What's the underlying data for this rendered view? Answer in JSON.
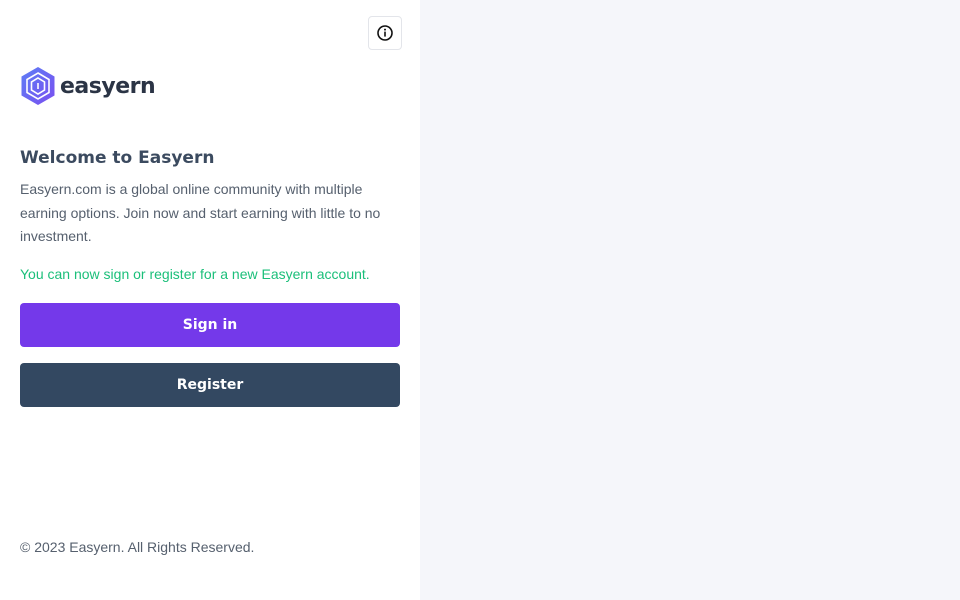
{
  "app": {
    "brand_name": "easyern"
  },
  "header": {
    "info_icon": "info-circle-icon"
  },
  "welcome": {
    "title": "Welcome to Easyern",
    "description": "Easyern.com is a global online community with multiple earning options. Join now and start earning with little to no investment.",
    "status_message": "You can now sign or register for a new Easyern account."
  },
  "actions": {
    "sign_in_label": "Sign in",
    "register_label": "Register"
  },
  "footer": {
    "copyright": "© 2023 Easyern. All Rights Reserved."
  },
  "colors": {
    "primary": "#7439ea",
    "secondary": "#334861",
    "success": "#1bbf7a",
    "logo_accent": "#6b5cf0",
    "right_panel_bg": "#f5f6fa"
  }
}
